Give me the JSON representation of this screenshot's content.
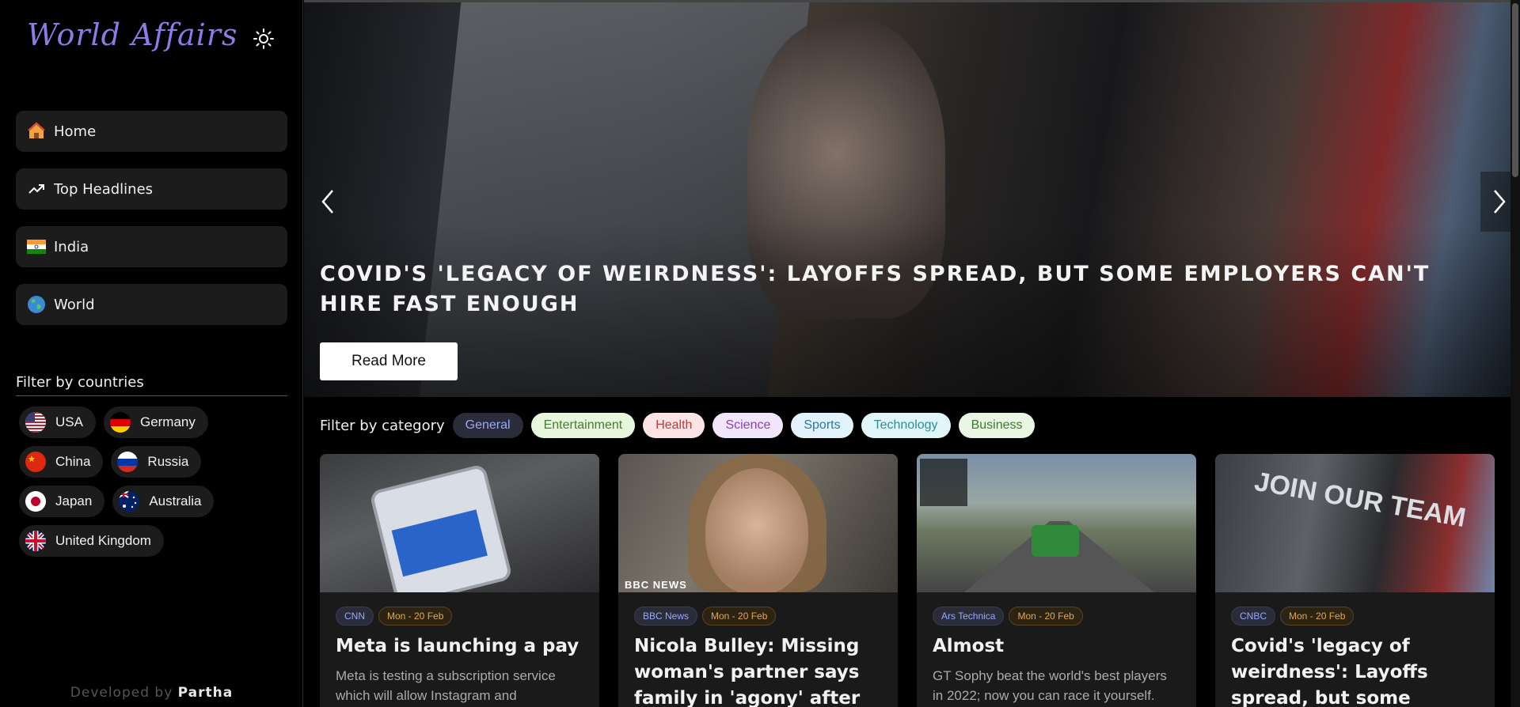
{
  "app": {
    "logo": "World Affairs",
    "theme_icon": "sun-icon"
  },
  "nav": {
    "items": [
      {
        "label": "Home",
        "icon": "house-icon"
      },
      {
        "label": "Top Headlines",
        "icon": "trending-up-icon"
      },
      {
        "label": "India",
        "icon": "india-flag-icon"
      },
      {
        "label": "World",
        "icon": "globe-icon"
      }
    ]
  },
  "countries": {
    "title": "Filter by countries",
    "items": [
      {
        "label": "USA",
        "flag": "usa-flag-icon"
      },
      {
        "label": "Germany",
        "flag": "germany-flag-icon"
      },
      {
        "label": "China",
        "flag": "china-flag-icon"
      },
      {
        "label": "Russia",
        "flag": "russia-flag-icon"
      },
      {
        "label": "Japan",
        "flag": "japan-flag-icon"
      },
      {
        "label": "Australia",
        "flag": "australia-flag-icon"
      },
      {
        "label": "United Kingdom",
        "flag": "uk-flag-icon"
      }
    ]
  },
  "footer": {
    "prefix": "Developed by",
    "author": "Partha"
  },
  "hero": {
    "title": "COVID'S 'LEGACY OF WEIRDNESS': LAYOFFS SPREAD, BUT SOME EMPLOYERS CAN'T HIRE FAST ENOUGH",
    "button": "Read More"
  },
  "categories": {
    "label": "Filter by category",
    "items": [
      {
        "label": "General",
        "bg": "#2a2c3a",
        "fg": "#9aa8ff"
      },
      {
        "label": "Entertainment",
        "bg": "#e6f7dd",
        "fg": "#4a7a2e"
      },
      {
        "label": "Health",
        "bg": "#fde4e4",
        "fg": "#c0393b"
      },
      {
        "label": "Science",
        "bg": "#f1e6fb",
        "fg": "#8a3fc0"
      },
      {
        "label": "Sports",
        "bg": "#e2f3fb",
        "fg": "#2a78a8"
      },
      {
        "label": "Technology",
        "bg": "#e0f6f9",
        "fg": "#2a8ea0"
      },
      {
        "label": "Business",
        "bg": "#e8f6e3",
        "fg": "#3e7a2c"
      }
    ]
  },
  "cards": [
    {
      "source": "CNN",
      "date": "Mon - 20 Feb",
      "title": "Meta is launching a pay",
      "desc": "Meta is testing a subscription service which will allow Instagram and"
    },
    {
      "source": "BBC News",
      "date": "Mon - 20 Feb",
      "title": "Nicola Bulley: Missing woman's partner says family in 'agony' after body found",
      "desc": "",
      "overlay": "BBC NEWS"
    },
    {
      "source": "Ars Technica",
      "date": "Mon - 20 Feb",
      "title": "Almost",
      "desc": "GT Sophy beat the world's best players in 2022; now you can race it yourself."
    },
    {
      "source": "CNBC",
      "date": "Mon - 20 Feb",
      "title": "Covid's 'legacy of weirdness': Layoffs spread, but some employers can't",
      "desc": "",
      "overlay": "JOIN OUR TEAM"
    }
  ]
}
